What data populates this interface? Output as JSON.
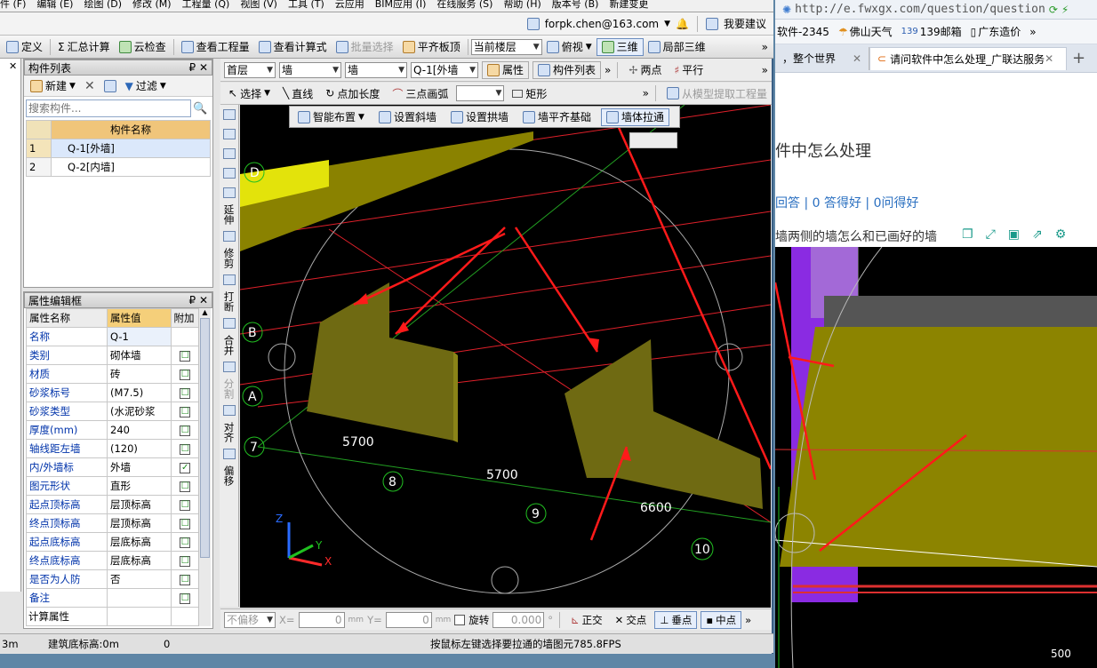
{
  "menubar": {
    "items": [
      "件 (F)",
      "编辑 (E)",
      "绘图 (D)",
      "修改 (M)",
      "工程量 (Q)",
      "视图 (V)",
      "工具 (T)",
      "云应用",
      "BIM应用 (I)",
      "在线服务 (S)",
      "帮助 (H)",
      "版本号 (B)",
      "新建变更"
    ]
  },
  "account": {
    "email": "forpk.chen@163.com",
    "suggest": "我要建议"
  },
  "toolbar1": {
    "define": "定义",
    "sum": "汇总计算",
    "cloudcheck": "云检查",
    "viewqty": "查看工程量",
    "viewformula": "查看计算式",
    "batchselect": "批量选择",
    "align_board": "平齐板顶",
    "floor": "当前楼层",
    "view": "俯视",
    "three_d": "三维",
    "local3d": "局部三维"
  },
  "component_list": {
    "title": "构件列表",
    "new": "新建",
    "filter": "过滤",
    "search_placeholder": "搜索构件...",
    "col_header": "构件名称",
    "rows": [
      {
        "no": "1",
        "name": "Q-1[外墙]"
      },
      {
        "no": "2",
        "name": "Q-2[内墙]"
      }
    ]
  },
  "property_panel": {
    "title": "属性编辑框",
    "headers": [
      "属性名称",
      "属性值",
      "附加"
    ],
    "rows": [
      {
        "name": "名称",
        "value": "Q-1",
        "check": ""
      },
      {
        "name": "类别",
        "value": "砌体墙",
        "check": "☐"
      },
      {
        "name": "材质",
        "value": "砖",
        "check": "☐"
      },
      {
        "name": "砂浆标号",
        "value": "(M7.5)",
        "check": "☐"
      },
      {
        "name": "砂浆类型",
        "value": "(水泥砂浆",
        "check": "☐"
      },
      {
        "name": "厚度(mm)",
        "value": "240",
        "check": "☐"
      },
      {
        "name": "轴线距左墙",
        "value": "(120)",
        "check": "☐"
      },
      {
        "name": "内/外墙标",
        "value": "外墙",
        "check": "✓"
      },
      {
        "name": "图元形状",
        "value": "直形",
        "check": "☐"
      },
      {
        "name": "起点顶标高",
        "value": "层顶标高",
        "check": "☐"
      },
      {
        "name": "终点顶标高",
        "value": "层顶标高",
        "check": "☐"
      },
      {
        "name": "起点底标高",
        "value": "层底标高",
        "check": "☐"
      },
      {
        "name": "终点底标高",
        "value": "层底标高",
        "check": "☐"
      },
      {
        "name": "是否为人防",
        "value": "否",
        "check": "☐"
      },
      {
        "name": "备注",
        "value": "",
        "check": "☐"
      },
      {
        "name": "计算属性",
        "value": "",
        "check": ""
      }
    ]
  },
  "toolbar2": {
    "floor": "首层",
    "type1": "墙",
    "type2": "墙",
    "component": "Q-1[外墙",
    "attr": "属性",
    "complist": "构件列表",
    "twopoint": "两点",
    "parallel": "平行"
  },
  "toolbar3": {
    "select": "选择",
    "line": "直线",
    "point_length": "点加长度",
    "arc3": "三点画弧",
    "rect": "矩形",
    "extract": "从模型提取工程量"
  },
  "toolbar4": {
    "smart": "智能布置",
    "slant": "设置斜墙",
    "arch": "设置拱墙",
    "align_base": "墙平齐基础",
    "pull_through": "墙体拉通"
  },
  "vertical_tools": [
    "延伸",
    "修剪",
    "打断",
    "合并",
    "分割",
    "对齐",
    "偏移"
  ],
  "viewport": {
    "axis_labels": [
      "D",
      "B",
      "A",
      "7",
      "8",
      "9",
      "10"
    ],
    "dimensions": [
      "5700",
      "5700",
      "6600"
    ],
    "triad": [
      "Z",
      "Y",
      "X"
    ]
  },
  "bottombar": {
    "nooffset": "不偏移",
    "x": "X=",
    "xval": "0",
    "unit": "mm",
    "y": "Y=",
    "yval": "0",
    "rotate": "旋转",
    "angle": "0.000",
    "ortho": "正交",
    "intersect": "交点",
    "perp": "垂点",
    "mid": "中点"
  },
  "status": {
    "left1": "3m",
    "left2": "建筑底标高:0m",
    "zero": "0",
    "hint": "按鼠标左键选择要拉通的墙图元",
    "fps": "785.8FPS"
  },
  "browser": {
    "url": "http://e.fwxgx.com/question/question",
    "bookmarks": [
      "软件-2345",
      "佛山天气",
      "139邮箱",
      "广东造价"
    ],
    "tab_inactive": "，整个世界",
    "tab_active": "请问软件中怎么处理_广联达服务",
    "page_title": "件中怎么处理",
    "stats": "回答 | 0 答得好 | 0问得好",
    "question": "墙两侧的墙怎么和已画好的墙",
    "num": "500"
  }
}
